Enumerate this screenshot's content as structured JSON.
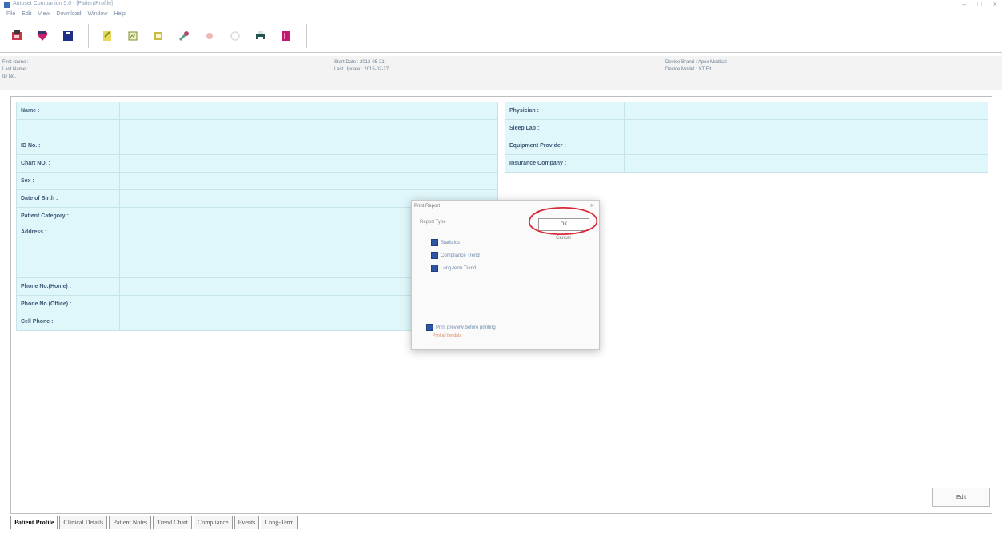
{
  "window": {
    "title": "Autoset Companion 5.0 - [PatientProfile]",
    "controls": [
      "–",
      "□",
      "×"
    ]
  },
  "menu": [
    "File",
    "Edit",
    "View",
    "Download",
    "Window",
    "Help"
  ],
  "toolbar": {
    "buttons": [
      {
        "icon": "open-patient-icon",
        "color": "#c8374a"
      },
      {
        "icon": "card-heart-icon",
        "color": "#c8206a"
      },
      {
        "icon": "save-disk-icon",
        "color": "#1f2f88"
      },
      {
        "icon": "notepad-icon",
        "color": "#d9c33a"
      },
      {
        "icon": "report-icon",
        "color": "#7d8b2e"
      },
      {
        "icon": "calendar-icon",
        "color": "#9a8f1a"
      },
      {
        "icon": "tools-icon",
        "color": "#5a9c8f"
      },
      {
        "icon": "faded-star-icon",
        "color": "#e9a7a7"
      },
      {
        "icon": "faded-circle-icon",
        "color": "#d8d8d8"
      },
      {
        "icon": "printer-icon",
        "color": "#25544f"
      },
      {
        "icon": "book-icon",
        "color": "#c2186f"
      }
    ]
  },
  "info": {
    "first_name": "First Name :",
    "last_name": "Last Name :",
    "id_no": "ID No. :",
    "start_date": "Start Date : 2012-05-21",
    "last_update": "Last Update : 2015-02-27",
    "device_brand": "Device Brand : Apex Medical",
    "device_model": "Device Model : XT Fit"
  },
  "patient_fields": [
    {
      "label": "Name :",
      "value": ""
    },
    {
      "label": "",
      "value": ""
    },
    {
      "label": "ID No. :",
      "value": ""
    },
    {
      "label": "Chart NO. :",
      "value": ""
    },
    {
      "label": "Sex :",
      "value": ""
    },
    {
      "label": "Date of Birth :",
      "value": ""
    },
    {
      "label": "Patient Category :",
      "value": ""
    },
    {
      "label": "Address :",
      "value": ""
    },
    {
      "label": "Phone No.(Home) :",
      "value": ""
    },
    {
      "label": "Phone No.(Office) :",
      "value": ""
    },
    {
      "label": "Cell Phone :",
      "value": ""
    }
  ],
  "provider_fields": [
    {
      "label": "Physician :",
      "value": ""
    },
    {
      "label": "Sleep Lab :",
      "value": ""
    },
    {
      "label": "Equipment Provider :",
      "value": ""
    },
    {
      "label": "Insurance Company :",
      "value": ""
    }
  ],
  "dialog": {
    "title": "Print Report",
    "close": "×",
    "report_type_label": "Report Type",
    "options": [
      "Statistics",
      "Compliance Trend",
      "Long-term Trend"
    ],
    "ok_label": "OK",
    "cancel_label": "Cancel",
    "preview_label": "Print preview before printing",
    "sub_link": "Print all the data"
  },
  "done_label": "Edit",
  "tabs": [
    "Patient Profile",
    "Clinical Details",
    "Patient Notes",
    "Trend Chart",
    "Compliance",
    "Events",
    "Long-Term"
  ],
  "colors": {
    "grid_bg": "#dff7fa",
    "grid_border": "#c4e4ea",
    "annotation": "#d8283a",
    "checkbox": "#2f55a4"
  }
}
